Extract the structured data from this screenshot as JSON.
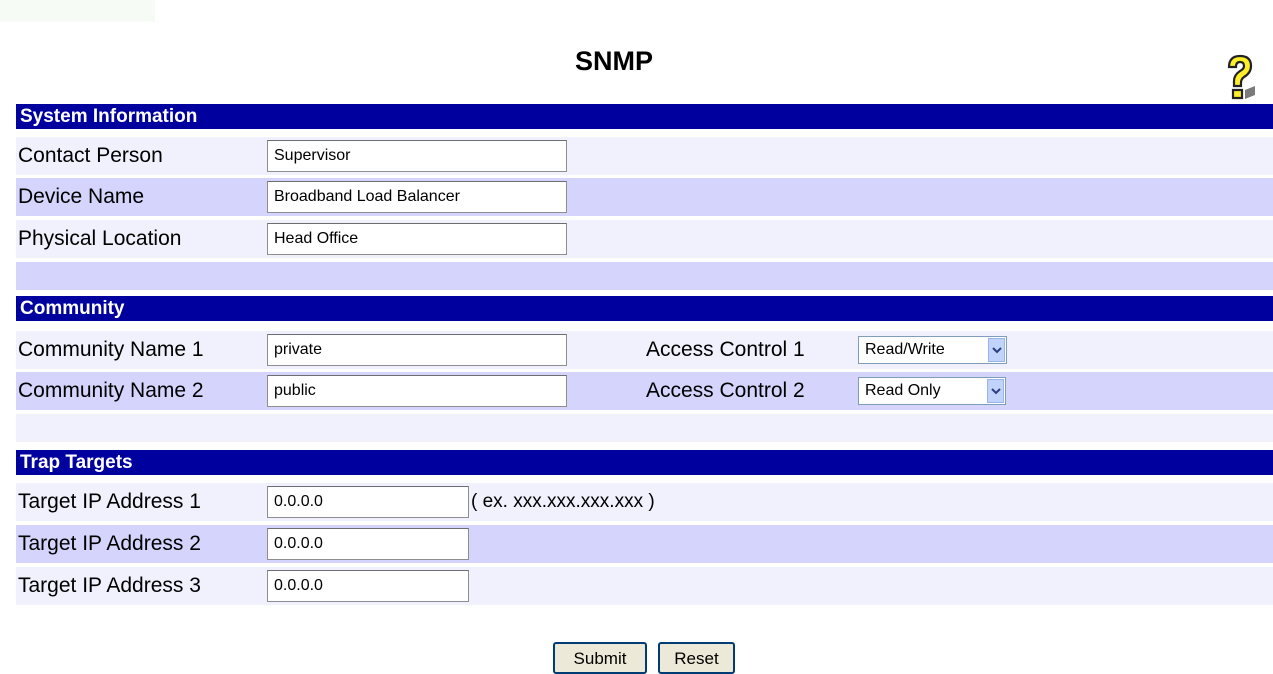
{
  "page": {
    "title": "SNMP",
    "help_icon": "help-question-icon"
  },
  "system_info": {
    "header": "System Information",
    "contact_label": "Contact Person",
    "contact_value": "Supervisor",
    "device_label": "Device Name",
    "device_value": "Broadband Load Balancer",
    "location_label": "Physical Location",
    "location_value": "Head Office"
  },
  "community": {
    "header": "Community",
    "name1_label": "Community Name 1",
    "name1_value": "private",
    "access1_label": "Access Control 1",
    "access1_value": "Read/Write",
    "name2_label": "Community Name 2",
    "name2_value": "public",
    "access2_label": "Access Control 2",
    "access2_value": "Read Only"
  },
  "trap_targets": {
    "header": "Trap Targets",
    "ip1_label": "Target IP Address 1",
    "ip1_value": "0.0.0.0",
    "ip_hint": "( ex. xxx.xxx.xxx.xxx )",
    "ip2_label": "Target IP Address 2",
    "ip2_value": "0.0.0.0",
    "ip3_label": "Target IP Address 3",
    "ip3_value": "0.0.0.0"
  },
  "buttons": {
    "submit_label": "Submit",
    "reset_label": "Reset"
  },
  "colors": {
    "section_header": "#00009e",
    "row_light": "#f1f1fe",
    "row_dark": "#d4d4fc"
  }
}
